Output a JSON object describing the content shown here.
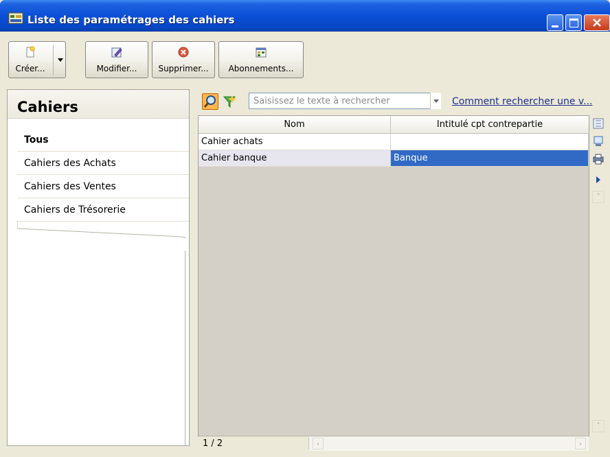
{
  "window": {
    "title": "Liste des paramétrages des cahiers"
  },
  "toolbar": {
    "create_label": "Créer...",
    "modify_label": "Modifier...",
    "delete_label": "Supprimer...",
    "subscriptions_label": "Abonnements..."
  },
  "sidebar": {
    "title": "Cahiers",
    "items": [
      {
        "label": "Tous",
        "active": true
      },
      {
        "label": "Cahiers des Achats",
        "active": false
      },
      {
        "label": "Cahiers des Ventes",
        "active": false
      },
      {
        "label": "Cahiers de Trésorerie",
        "active": false
      }
    ]
  },
  "search": {
    "placeholder": "Saisissez le texte à rechercher",
    "help_link": "Comment rechercher une v..."
  },
  "grid": {
    "columns": [
      "Nom",
      "Intitulé cpt contrepartie"
    ],
    "rows": [
      {
        "nom": "Cahier achats",
        "intitule": "",
        "selected": false
      },
      {
        "nom": "Cahier banque",
        "intitule": "Banque",
        "selected": true
      }
    ],
    "pager": "1 / 2"
  },
  "colors": {
    "titlebar": "#0a4fd6",
    "selection": "#316ac5",
    "link": "#1d2f8c"
  },
  "icons": {
    "window": "app-icon",
    "create": "new-document-icon",
    "modify": "edit-icon",
    "delete": "delete-icon",
    "subscriptions": "subscriptions-icon",
    "search": "search-icon",
    "filter": "filter-icon"
  }
}
